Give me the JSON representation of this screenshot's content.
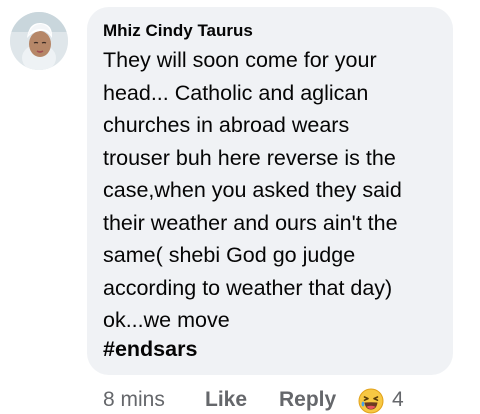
{
  "comment": {
    "author": "Mhiz Cindy Taurus",
    "lines": [
      "They will soon come for your",
      "head... Catholic and aglican",
      "churches in abroad wears",
      "trouser buh here reverse is the",
      "case,when you asked they said",
      "their weather and ours ain't the",
      "same( shebi God go judge",
      "according to weather that day)",
      "ok...we move"
    ],
    "hashtag": "#endsars"
  },
  "actions": {
    "time": "8 mins",
    "like_label": "Like",
    "reply_label": "Reply",
    "reaction_icon": "laughing-emoji-icon",
    "reaction_count": "4"
  },
  "colors": {
    "bubble": "#f0f2f5",
    "text": "#050505",
    "meta": "#65676b"
  }
}
